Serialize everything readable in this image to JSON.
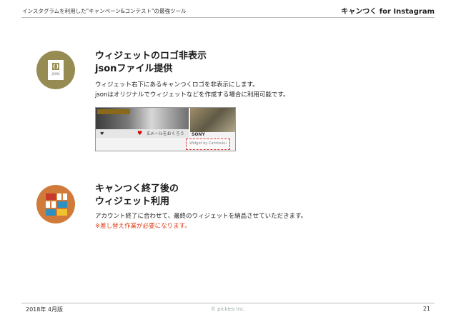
{
  "header": {
    "left_text": "インスタグラムを利用した\"キャンペーン&コンテスト\"の最強ツール",
    "brand": "キャンつく for Instagram"
  },
  "feature1": {
    "icon": "json-file-icon",
    "icon_label": "JSON",
    "icon_glyph": "{}",
    "title_line1": "ウィジェットのロゴ非表示",
    "title_line2": "jsonファイル提供",
    "desc_line1": "ウィジェット右下にあるキャンつくロゴを非表示にします。",
    "desc_line2": "jsonはオリジナルでウィジェットなどを作成する場合に利用可能です。",
    "screenshot": {
      "bar_text": "Eメールをおくろう",
      "sony_text": "SONY",
      "watermark_text": "Widget by Camtsuku"
    }
  },
  "feature2": {
    "icon": "widget-grid-icon",
    "title_line1": "キャンつく終了後の",
    "title_line2": "ウィジェット利用",
    "desc_line1": "アカウント終了に合わせて、最終のウィジェットを納品させていただきます。",
    "note": "※差し替え作業が必要になります。"
  },
  "footer": {
    "date": "2018年 4月版",
    "copyright": "© pickles Inc.",
    "page_number": "21"
  },
  "colors": {
    "olive": "#968c53",
    "orange": "#d07b3a",
    "note_red": "#e0421e"
  }
}
